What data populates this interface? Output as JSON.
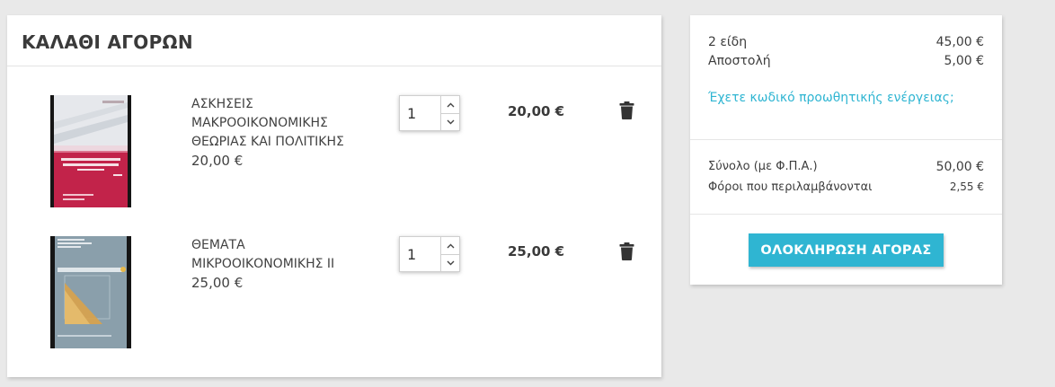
{
  "cart": {
    "title": "ΚΑΛΑΘΙ ΑΓΟΡΩΝ",
    "items": [
      {
        "name": "ΑΣΚΗΣΕΙΣ ΜΑΚΡΟΟΙΚΟΝΟΜΙΚΗΣ ΘΕΩΡΙΑΣ ΚΑΙ ΠΟΛΙΤΙΚΗΣ",
        "unit_price": "20,00 €",
        "quantity": "1",
        "line_total": "20,00 €"
      },
      {
        "name": "ΘΕΜΑΤΑ ΜΙΚΡΟΟΙΚΟΝΟΜΙΚΗΣ ΙΙ",
        "unit_price": "25,00 €",
        "quantity": "1",
        "line_total": "25,00 €"
      }
    ]
  },
  "summary": {
    "items_label": "2 είδη",
    "items_value": "45,00 €",
    "shipping_label": "Αποστολή",
    "shipping_value": "5,00 €",
    "promo_link": "Έχετε κωδικό προωθητικής ενέργειας;",
    "total_label": "Σύνολο (με Φ.Π.Α.)",
    "total_value": "50,00 €",
    "taxes_label": "Φόροι που περιλαμβάνονται",
    "taxes_value": "2,55 €",
    "checkout_label": "ΟΛΟΚΛΗΡΩΣΗ ΑΓΟΡΑΣ"
  },
  "colors": {
    "accent": "#2fb5d2",
    "background": "#e9e9e9"
  },
  "icons": [
    "trash-icon",
    "chevron-up-icon",
    "chevron-down-icon"
  ]
}
